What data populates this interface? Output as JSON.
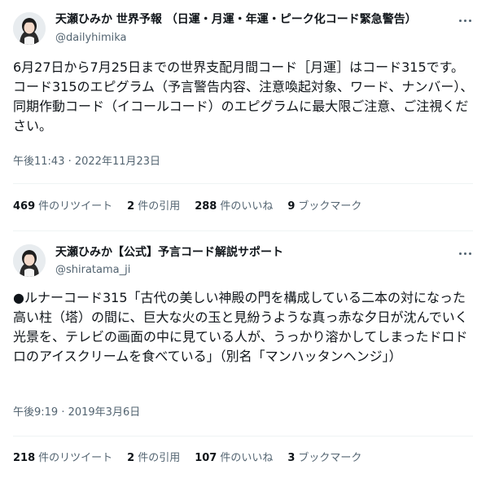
{
  "tweets": [
    {
      "author_name": "天瀬ひみか 世界予報 （日運・月運・年運・ピーク化コード緊急警告）",
      "handle": "@dailyhimika",
      "text": "6月27日から7月25日までの世界支配月間コード［月運］はコード315です。コード315のエピグラム（予言警告内容、注意喚起対象、ワード、ナンバー）、同期作動コード（イコールコード）のエピグラムに最大限ご注意、ご注視ください。",
      "timestamp": "午後11:43 · 2022年11月23日",
      "stats": {
        "retweets_num": "469",
        "retweets_label": "件のリツイート",
        "quotes_num": "2",
        "quotes_label": "件の引用",
        "likes_num": "288",
        "likes_label": "件のいいね",
        "bookmarks_num": "9",
        "bookmarks_label": "ブックマーク"
      },
      "avatar_icon": "profile-photo"
    },
    {
      "author_name": "天瀬ひみか【公式】予言コード解説サポート",
      "handle": "@shiratama_ji",
      "text": "●ルナーコード315「古代の美しい神殿の門を構成している二本の対になった高い柱（塔）の間に、巨大な火の玉と見紛うような真っ赤な夕日が沈んでいく光景を、テレビの画面の中に見ている人が、うっかり溶かしてしまったドロドロのアイスクリームを食べている」（別名「マンハッタンヘンジ」）",
      "timestamp": "午後9:19 · 2019年3月6日",
      "stats": {
        "retweets_num": "218",
        "retweets_label": "件のリツイート",
        "quotes_num": "2",
        "quotes_label": "件の引用",
        "likes_num": "107",
        "likes_label": "件のいいね",
        "bookmarks_num": "3",
        "bookmarks_label": "ブックマーク"
      },
      "avatar_icon": "profile-photo"
    }
  ],
  "colors": {
    "text_primary": "#0f1419",
    "text_secondary": "#536471",
    "divider": "#eff3f4",
    "background": "#ffffff"
  },
  "icons": {
    "more": "more-horizontal-icon"
  }
}
